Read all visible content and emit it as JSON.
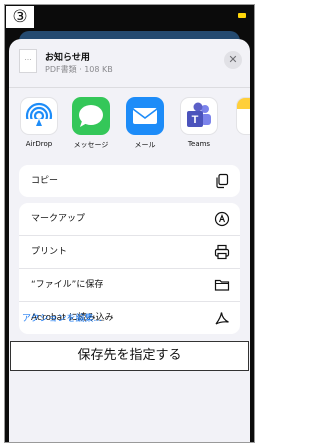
{
  "step_badge": "③",
  "file": {
    "name": "お知らせ用",
    "meta": "PDF書類 · 108 KB",
    "thumb_glyph": "…"
  },
  "close_glyph": "✕",
  "apps": [
    {
      "label": "AirDrop",
      "icon": "airdrop-icon"
    },
    {
      "label": "メッセージ",
      "icon": "messages-icon"
    },
    {
      "label": "メール",
      "icon": "mail-icon"
    },
    {
      "label": "Teams",
      "icon": "teams-icon"
    },
    {
      "label": "",
      "icon": "notes-icon"
    }
  ],
  "actions_group1": [
    {
      "label": "コピー",
      "icon": "copy-icon"
    }
  ],
  "actions_group2": [
    {
      "label": "マークアップ",
      "icon": "markup-icon"
    },
    {
      "label": "プリント",
      "icon": "printer-icon"
    },
    {
      "label": "“ファイル”に保存",
      "icon": "folder-icon"
    },
    {
      "label": "Acrobat に読み込み",
      "icon": "acrobat-icon"
    }
  ],
  "edit_actions": "アクションを編集...",
  "save_destination": "保存先を指定する",
  "colors": {
    "link_blue": "#1f7cf2",
    "messages_green": "#34c759",
    "mail_blue": "#1d8cf8",
    "teams_purple": "#5b5fc7",
    "sheet_bg": "#f2f2f7"
  }
}
